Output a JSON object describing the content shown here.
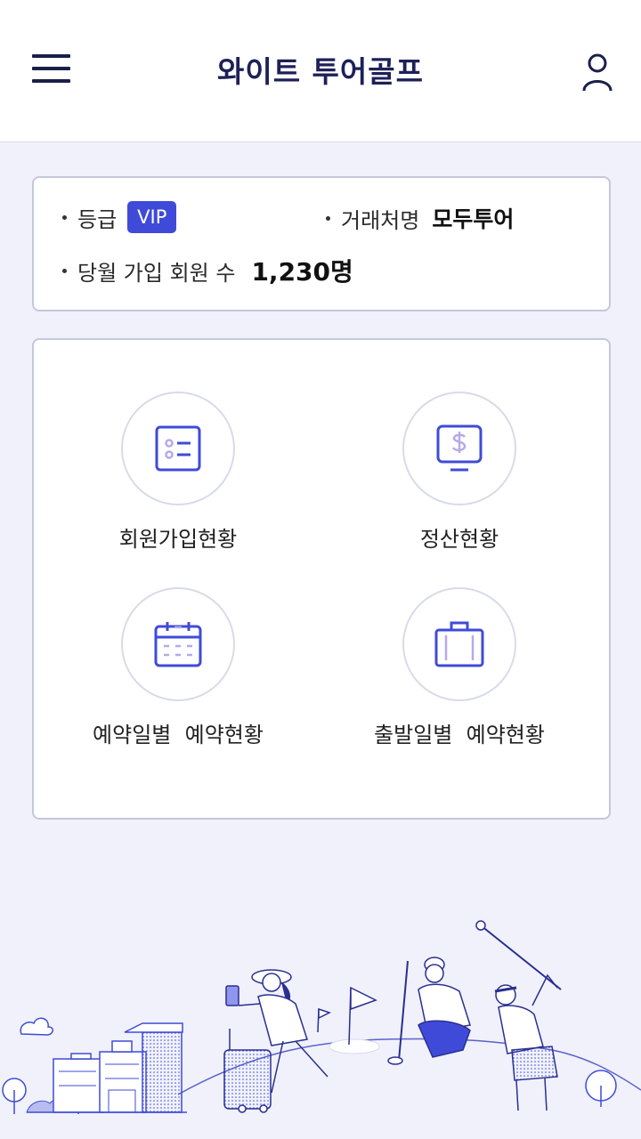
{
  "header": {
    "title": "와이트 투어골프"
  },
  "info": {
    "grade_label": "등급",
    "grade_value": "VIP",
    "partner_label": "거래처명",
    "partner_value": "모두투어",
    "members_label": "당월 가입 회원 수",
    "members_value": "1,230명"
  },
  "menu": {
    "items": [
      {
        "label": "회원가입현황",
        "icon": "member-list-icon"
      },
      {
        "label": "정산현황",
        "icon": "settlement-dollar-icon"
      },
      {
        "label": "예약일별  예약현황",
        "icon": "calendar-icon"
      },
      {
        "label": "출발일별  예약현황",
        "icon": "suitcase-icon"
      }
    ]
  },
  "colors": {
    "accent": "#3f4bd8",
    "title": "#1e2058",
    "icon_light": "#b6a9ec",
    "background": "#f0f1fb"
  }
}
